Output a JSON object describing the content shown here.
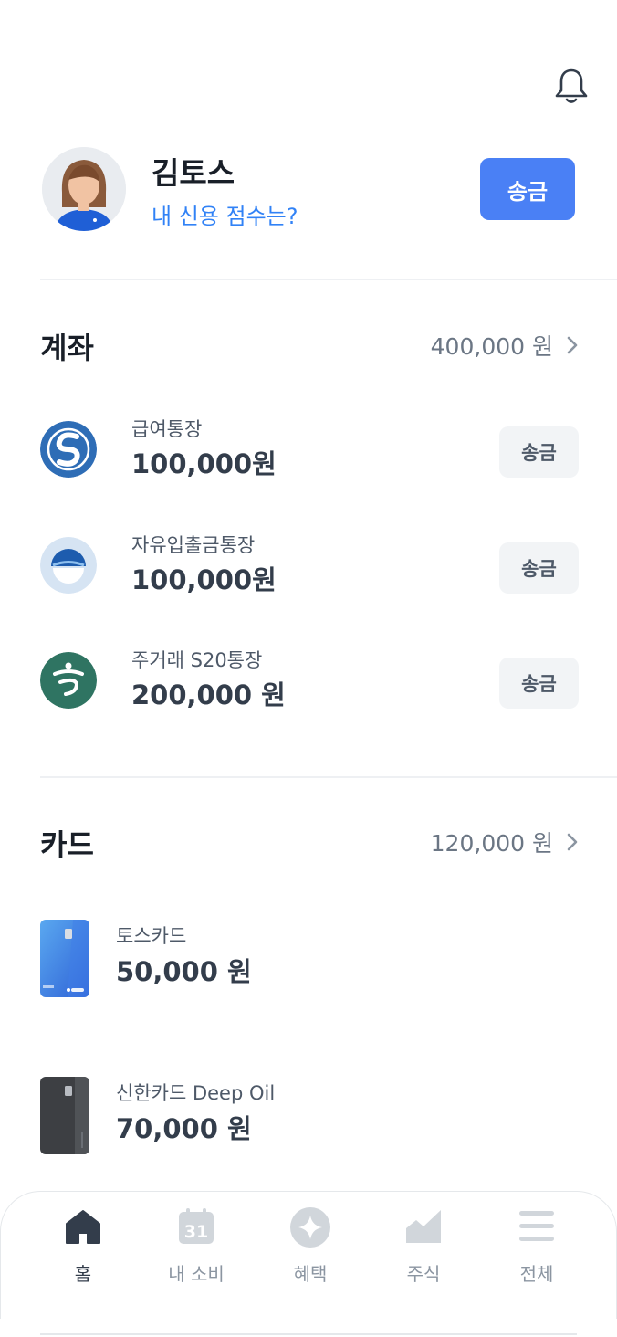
{
  "header": {
    "icon": "bell-icon"
  },
  "profile": {
    "name": "김토스",
    "credit_link": "내 신용 점수는?",
    "send_label": "송금"
  },
  "accounts": {
    "title": "계좌",
    "total": "400,000 원",
    "items": [
      {
        "name": "급여통장",
        "amount": "100,000원",
        "send_label": "송금",
        "logo": "shinhan-bank-logo"
      },
      {
        "name": "자유입출금통장",
        "amount": "100,000원",
        "send_label": "송금",
        "logo": "woori-bank-logo"
      },
      {
        "name": "주거래 S20통장",
        "amount": "200,000 원",
        "send_label": "송금",
        "logo": "hana-bank-logo"
      }
    ]
  },
  "cards": {
    "title": "카드",
    "total": "120,000 원",
    "items": [
      {
        "name": "토스카드",
        "amount": "50,000 원",
        "image": "toss-card-image"
      },
      {
        "name": "신한카드 Deep Oil",
        "amount": "70,000 원",
        "image": "shinhan-card-image"
      }
    ]
  },
  "tabbar": {
    "items": [
      {
        "label": "홈",
        "icon": "home-icon",
        "active": true
      },
      {
        "label": "내 소비",
        "icon": "calendar-icon",
        "calendar_text": "31",
        "active": false
      },
      {
        "label": "혜택",
        "icon": "sparkle-icon",
        "active": false
      },
      {
        "label": "주식",
        "icon": "chart-icon",
        "active": false
      },
      {
        "label": "전체",
        "icon": "menu-icon",
        "active": false
      }
    ]
  },
  "colors": {
    "accent": "#4a80f5",
    "link": "#3182f6",
    "text": "#333d4b",
    "muted": "#6b7684"
  }
}
